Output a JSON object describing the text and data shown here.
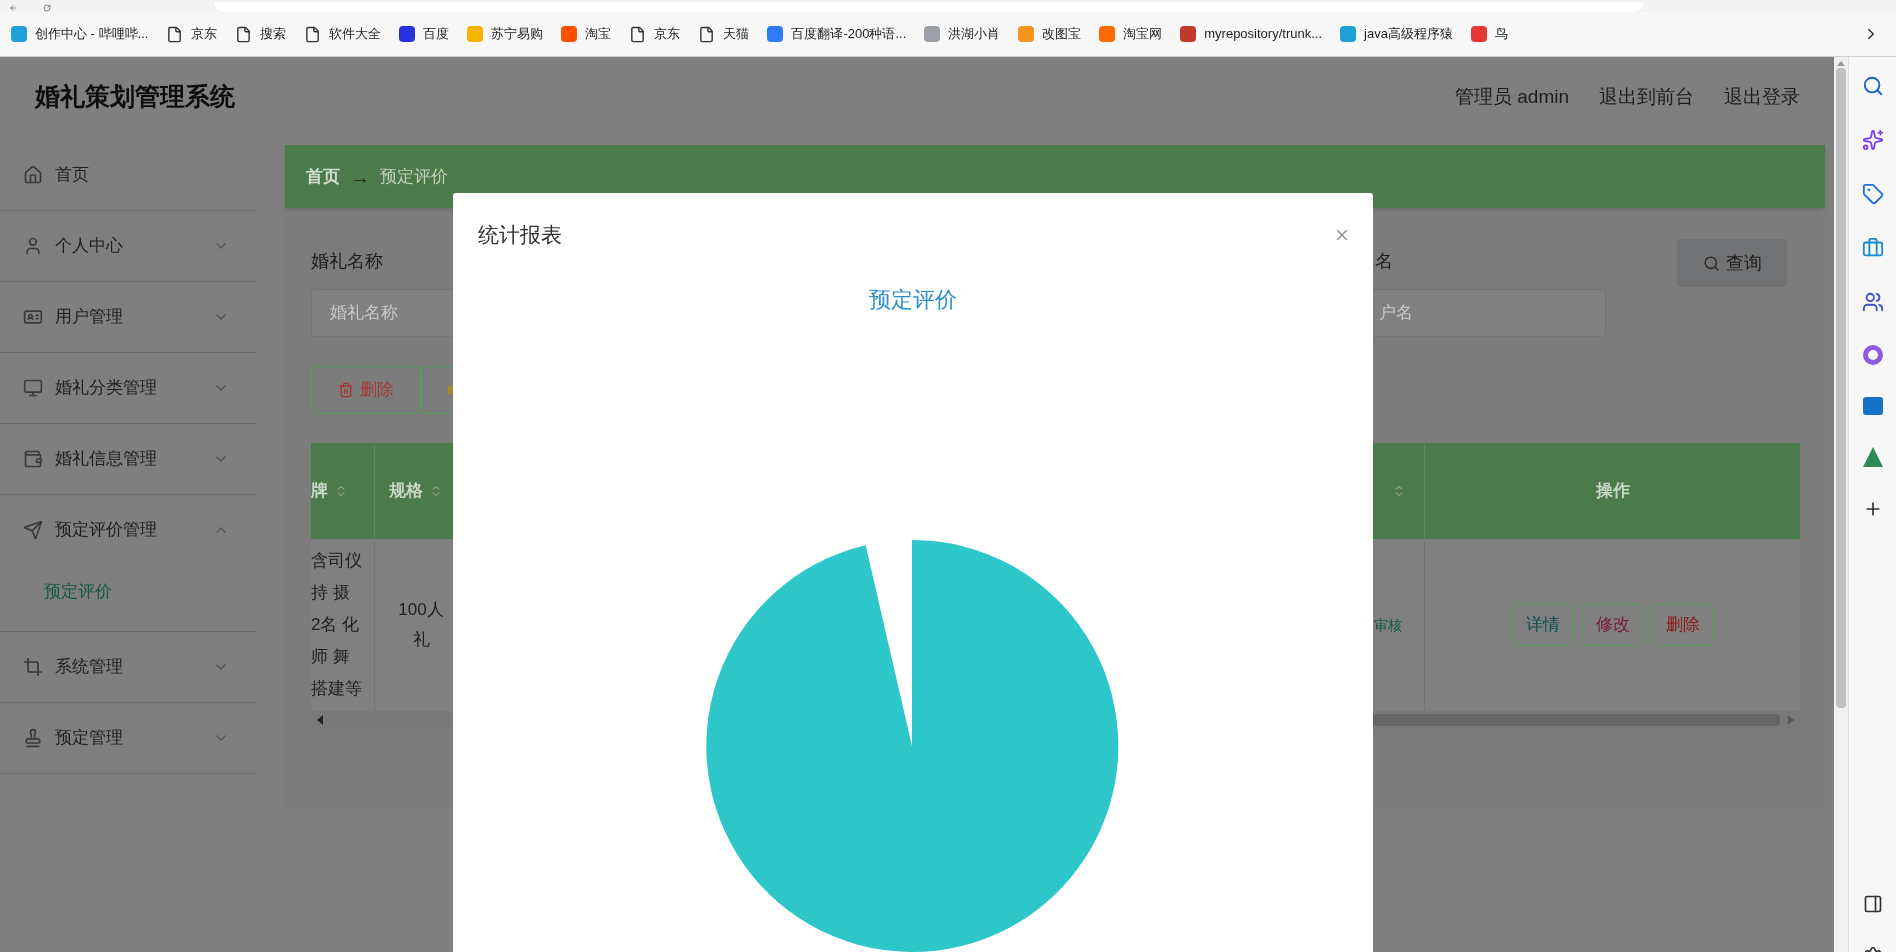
{
  "browser": {
    "bookmarks": [
      {
        "label": "创作中心 - 哔哩哔...",
        "kind": "site",
        "color": "#20a0d8"
      },
      {
        "label": "京东",
        "kind": "page"
      },
      {
        "label": "搜索",
        "kind": "page"
      },
      {
        "label": "软件大全",
        "kind": "page"
      },
      {
        "label": "百度",
        "kind": "site",
        "color": "#2932e1"
      },
      {
        "label": "苏宁易购",
        "kind": "site",
        "color": "#f5b400"
      },
      {
        "label": "淘宝",
        "kind": "site",
        "color": "#ff5000"
      },
      {
        "label": "京东",
        "kind": "page"
      },
      {
        "label": "天猫",
        "kind": "page"
      },
      {
        "label": "百度翻译-200种语...",
        "kind": "site",
        "color": "#2f7bf5"
      },
      {
        "label": "洪湖小肖",
        "kind": "site",
        "color": "#9aa0a6"
      },
      {
        "label": "改图宝",
        "kind": "site",
        "color": "#f7941d"
      },
      {
        "label": "淘宝网",
        "kind": "site",
        "color": "#ff6a00"
      },
      {
        "label": "myrepository/trunk...",
        "kind": "site",
        "color": "#c0392b"
      },
      {
        "label": "java高级程序猿",
        "kind": "site",
        "color": "#20a0d8"
      },
      {
        "label": "鸟",
        "kind": "site",
        "color": "#e53935"
      }
    ]
  },
  "header": {
    "title": "婚礼策划管理系统",
    "links": [
      "管理员 admin",
      "退出到前台",
      "退出登录"
    ]
  },
  "sidebar": {
    "items": [
      {
        "label": "首页",
        "kind": "link"
      },
      {
        "label": "个人中心",
        "kind": "menu",
        "expanded": false
      },
      {
        "label": "用户管理",
        "kind": "menu",
        "expanded": false
      },
      {
        "label": "婚礼分类管理",
        "kind": "menu",
        "expanded": false
      },
      {
        "label": "婚礼信息管理",
        "kind": "menu",
        "expanded": false
      },
      {
        "label": "预定评价管理",
        "kind": "menu",
        "expanded": true,
        "children": [
          {
            "label": "预定评价",
            "selected": true
          }
        ]
      },
      {
        "label": "系统管理",
        "kind": "menu",
        "expanded": false
      },
      {
        "label": "预定管理",
        "kind": "menu",
        "expanded": false
      }
    ]
  },
  "breadcrumb": {
    "home": "首页",
    "separator": "→",
    "current": "预定评价"
  },
  "search": {
    "fields": [
      {
        "label": "婚礼名称",
        "placeholder": "婚礼名称"
      },
      {
        "label": "名",
        "placeholder": "户名"
      }
    ],
    "button": "查询"
  },
  "toolbar": {
    "buttons": [
      {
        "label": "删除",
        "kind": "delete"
      },
      {
        "kind": "partial"
      }
    ]
  },
  "table": {
    "columns": [
      {
        "label": "牌",
        "sortable": true
      },
      {
        "label": "规格",
        "sortable": true
      },
      {
        "sortable": true
      },
      {
        "label": "操作",
        "sortable": false
      }
    ],
    "rows": [
      {
        "column_1": [
          "含司仪",
          "持 摄",
          "2名 化",
          "师 舞",
          "搭建等"
        ],
        "column_2": [
          "100人",
          "礼"
        ],
        "column_3": "审核",
        "actions": [
          {
            "label": "详情",
            "kind": "detail"
          },
          {
            "label": "修改",
            "kind": "edit"
          },
          {
            "label": "删除",
            "kind": "delete"
          }
        ]
      }
    ]
  },
  "modal": {
    "title": "统计报表",
    "chart_title": "预定评价"
  }
}
